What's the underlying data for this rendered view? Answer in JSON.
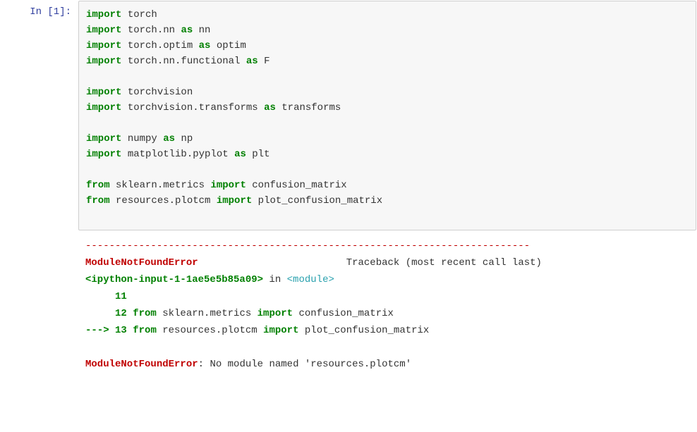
{
  "prompt": {
    "in_label": "In  [1]:"
  },
  "code": {
    "lines": [
      [
        {
          "k": "g",
          "t": "import"
        },
        {
          "k": "p",
          "t": " torch"
        }
      ],
      [
        {
          "k": "g",
          "t": "import"
        },
        {
          "k": "p",
          "t": " torch.nn "
        },
        {
          "k": "g",
          "t": "as"
        },
        {
          "k": "p",
          "t": " nn"
        }
      ],
      [
        {
          "k": "g",
          "t": "import"
        },
        {
          "k": "p",
          "t": " torch.optim "
        },
        {
          "k": "g",
          "t": "as"
        },
        {
          "k": "p",
          "t": " optim"
        }
      ],
      [
        {
          "k": "g",
          "t": "import"
        },
        {
          "k": "p",
          "t": " torch.nn.functional "
        },
        {
          "k": "g",
          "t": "as"
        },
        {
          "k": "p",
          "t": " F"
        }
      ],
      [],
      [
        {
          "k": "g",
          "t": "import"
        },
        {
          "k": "p",
          "t": " torchvision"
        }
      ],
      [
        {
          "k": "g",
          "t": "import"
        },
        {
          "k": "p",
          "t": " torchvision.transforms "
        },
        {
          "k": "g",
          "t": "as"
        },
        {
          "k": "p",
          "t": " transforms"
        }
      ],
      [],
      [
        {
          "k": "g",
          "t": "import"
        },
        {
          "k": "p",
          "t": " numpy "
        },
        {
          "k": "g",
          "t": "as"
        },
        {
          "k": "p",
          "t": " np"
        }
      ],
      [
        {
          "k": "g",
          "t": "import"
        },
        {
          "k": "p",
          "t": " matplotlib.pyplot "
        },
        {
          "k": "g",
          "t": "as"
        },
        {
          "k": "p",
          "t": " plt"
        }
      ],
      [],
      [
        {
          "k": "g",
          "t": "from"
        },
        {
          "k": "p",
          "t": " sklearn.metrics "
        },
        {
          "k": "g",
          "t": "import"
        },
        {
          "k": "p",
          "t": " confusion_matrix"
        }
      ],
      [
        {
          "k": "g",
          "t": "from"
        },
        {
          "k": "p",
          "t": " resources.plotcm "
        },
        {
          "k": "g",
          "t": "import"
        },
        {
          "k": "p",
          "t": " plot_confusion_matrix"
        }
      ],
      []
    ]
  },
  "traceback": {
    "dash_line": "---------------------------------------------------------------------------",
    "err_name": "ModuleNotFoundError",
    "err_right": "Traceback (most recent call last)",
    "loc_source": "<ipython-input-1-1ae5e5b85a09>",
    "loc_in": " in ",
    "loc_module": "<module>",
    "line11_num": "     11 ",
    "line12_num": "     12 ",
    "line12": [
      {
        "k": "g",
        "t": "from"
      },
      {
        "k": "p",
        "t": " sklearn.metrics "
      },
      {
        "k": "g",
        "t": "import"
      },
      {
        "k": "p",
        "t": " confusion_matrix"
      }
    ],
    "arrow": "---> ",
    "line13_num": "13 ",
    "line13": [
      {
        "k": "g",
        "t": "from"
      },
      {
        "k": "p",
        "t": " resources.plotcm "
      },
      {
        "k": "g",
        "t": "import"
      },
      {
        "k": "p",
        "t": " plot_confusion_matrix"
      }
    ],
    "final_err": "ModuleNotFoundError",
    "final_msg": ": No module named 'resources.plotcm'"
  }
}
